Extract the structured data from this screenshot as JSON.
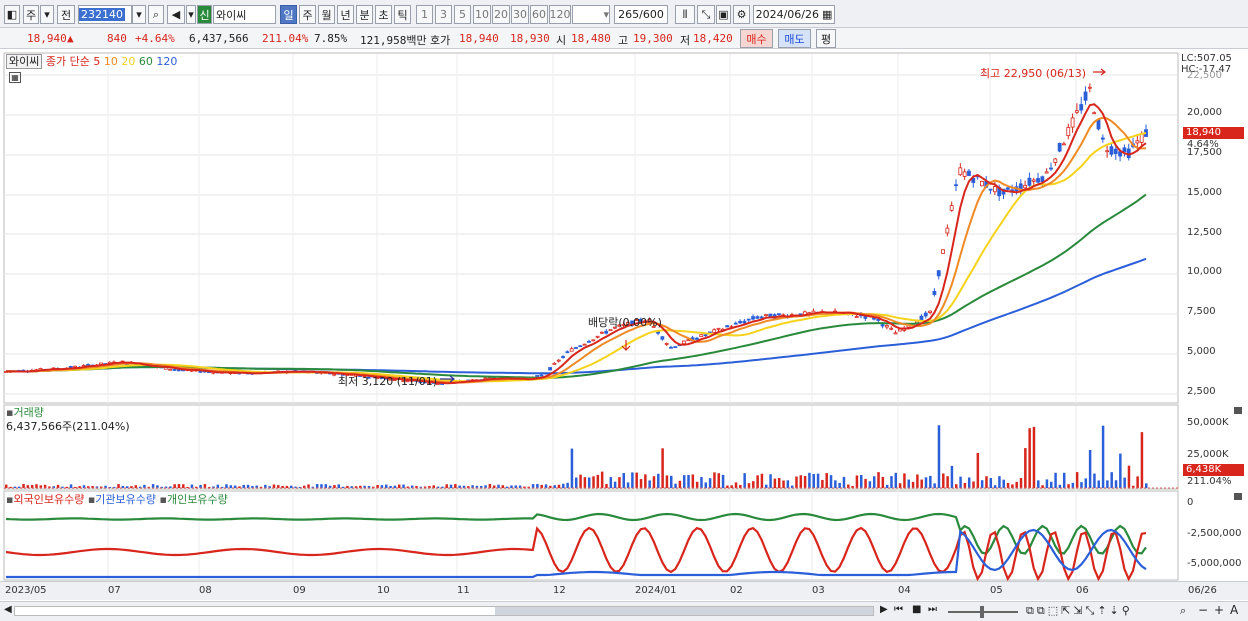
{
  "toolbar": {
    "market_label": "주",
    "prev_label": "전",
    "code": "232140",
    "badge": "신",
    "name": "와이씨",
    "periods": [
      "일",
      "주",
      "월",
      "년",
      "분",
      "초",
      "틱"
    ],
    "intervals": [
      "1",
      "3",
      "5",
      "10",
      "20",
      "30",
      "60",
      "120"
    ],
    "count": "265",
    "count_total": "/600",
    "date": "2024/06/26"
  },
  "info": {
    "price": "18,940",
    "arrow": "▲",
    "change": "840",
    "change_pct": "+4.64%",
    "volume": "6,437,566",
    "volume_ratio": "211.04%",
    "turnover": "7.85%",
    "amount": "121,958백만",
    "quote_label": "호가",
    "ask": "18,940",
    "bid": "18,930",
    "open_label": "시",
    "open": "18,480",
    "high_label": "고",
    "high": "19,300",
    "low_label": "저",
    "low": "18,420",
    "buy_label": "매수",
    "sell_label": "매도",
    "eval_label": "평"
  },
  "price_panel": {
    "stock_name": "와이씨",
    "ma_label": "종가 단순",
    "ma_periods": [
      {
        "p": "5",
        "color": "#d8261c"
      },
      {
        "p": "10",
        "color": "#f08a24"
      },
      {
        "p": "20",
        "color": "#f4d31a"
      },
      {
        "p": "60",
        "color": "#2a8a3c"
      },
      {
        "p": "120",
        "color": "#2b5fd9"
      }
    ],
    "lc": "LC:507.05",
    "hc": "HC:-17.47",
    "y_ticks": [
      "22,500",
      "20,000",
      "17,500",
      "15,000",
      "12,500",
      "10,000",
      "7,500",
      "5,000",
      "2,500"
    ],
    "high_annotation": "최고 22,950 (06/13)",
    "low_annotation": "최저 3,120 (11/01)",
    "dividend_annotation": "배당락(0.00%)",
    "last_price_tag": "18,940",
    "last_pct_tag": "4.64%"
  },
  "volume_panel": {
    "title": "거래량",
    "value": "6,437,566주(211.04%)",
    "y_ticks": [
      "50,000K",
      "25,000K"
    ],
    "last_tag": "6,438K",
    "last_pct": "211.04%"
  },
  "holding_panel": {
    "legend": [
      {
        "name": "외국인보유수량",
        "color": "#d8261c"
      },
      {
        "name": "기관보유수량",
        "color": "#2b5fd9"
      },
      {
        "name": "개인보유수량",
        "color": "#2a8a3c"
      }
    ],
    "y_ticks": [
      "0",
      "-2,500,000",
      "-5,000,000"
    ]
  },
  "x_axis": [
    "2023/05",
    "07",
    "08",
    "09",
    "10",
    "11",
    "12",
    "2024/01",
    "02",
    "03",
    "04",
    "05",
    "06",
    "06/26"
  ],
  "colors": {
    "up": "#d8261c",
    "down": "#2b5fd9",
    "ma5": "#d8261c",
    "ma10": "#f08a24",
    "ma20": "#f4d31a",
    "ma60": "#2a8a3c",
    "ma120": "#2b5fd9"
  }
}
